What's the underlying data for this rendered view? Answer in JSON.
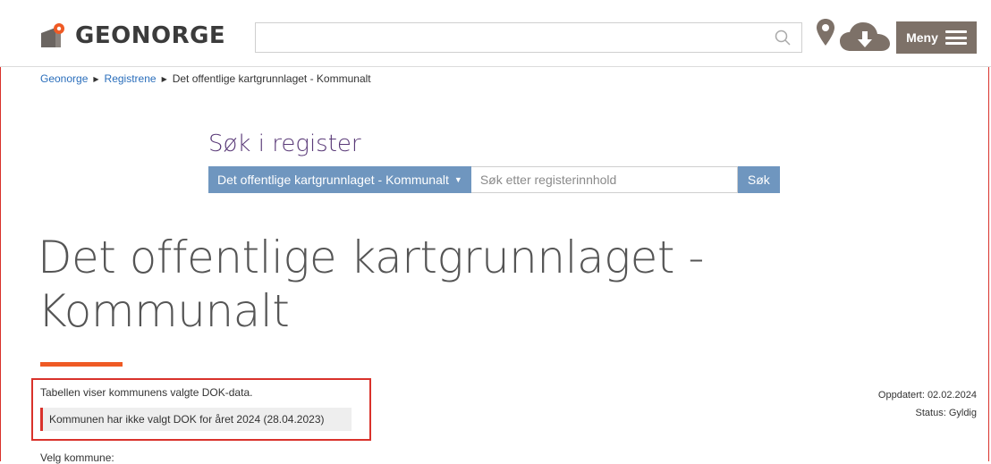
{
  "header": {
    "logo_text": "GEONORGE",
    "search": {
      "value": "",
      "placeholder": ""
    },
    "menu_label": "Meny"
  },
  "breadcrumb": {
    "items": [
      "Geonorge",
      "Registrene",
      "Det offentlige kartgrunnlaget - Kommunalt"
    ]
  },
  "register_search": {
    "title": "Søk i register",
    "dropdown_label": "Det offentlige kartgrunnlaget - Kommunalt",
    "input_placeholder": "Søk etter registerinnhold",
    "button_label": "Søk"
  },
  "main": {
    "title_line1": "Det offentlige kartgrunnlaget -",
    "title_line2": "Kommunalt",
    "description": "Tabellen viser kommunens valgte DOK-data.",
    "notice": "Kommunen har ikke valgt DOK for året 2024 (28.04.2023)",
    "updated": "Oppdatert: 02.02.2024",
    "status": "Status: Gyldig",
    "select_municipality_label": "Velg kommune:"
  },
  "colors": {
    "accent_blue": "#6f96bf",
    "menu_brown": "#7d7168",
    "highlight_red": "#d9322b",
    "title_bar_orange": "#ef5a24",
    "register_title_purple": "#5a3a78"
  },
  "icons": [
    "geonorge-logo-icon",
    "search-icon",
    "map-pin-icon",
    "cloud-download-icon",
    "hamburger-icon"
  ]
}
